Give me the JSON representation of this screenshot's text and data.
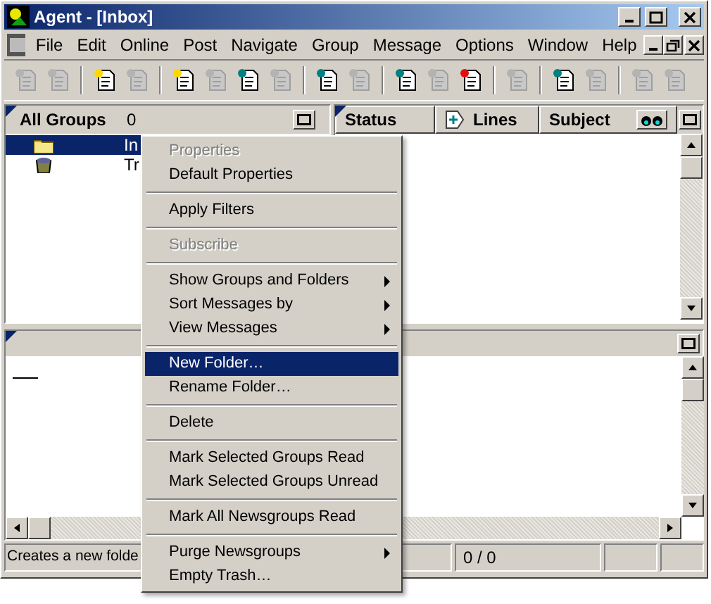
{
  "window": {
    "title": "Agent - [Inbox]"
  },
  "menu_bar": [
    "File",
    "Edit",
    "Online",
    "Post",
    "Navigate",
    "Group",
    "Message",
    "Options",
    "Window",
    "Help"
  ],
  "toolbar": [
    {
      "kind": "button",
      "disabled": true
    },
    {
      "kind": "button",
      "disabled": true
    },
    {
      "kind": "separator"
    },
    {
      "kind": "button",
      "disabled": false
    },
    {
      "kind": "button",
      "disabled": true
    },
    {
      "kind": "separator"
    },
    {
      "kind": "button",
      "disabled": false
    },
    {
      "kind": "button",
      "disabled": true
    },
    {
      "kind": "button",
      "disabled": false
    },
    {
      "kind": "button",
      "disabled": true
    },
    {
      "kind": "separator"
    },
    {
      "kind": "button",
      "disabled": false
    },
    {
      "kind": "button",
      "disabled": true
    },
    {
      "kind": "separator"
    },
    {
      "kind": "button",
      "disabled": false
    },
    {
      "kind": "button",
      "disabled": true
    },
    {
      "kind": "button",
      "disabled": false
    },
    {
      "kind": "separator"
    },
    {
      "kind": "button",
      "disabled": true
    },
    {
      "kind": "separator"
    },
    {
      "kind": "button",
      "disabled": false
    },
    {
      "kind": "button",
      "disabled": true
    },
    {
      "kind": "separator"
    },
    {
      "kind": "button",
      "disabled": true
    },
    {
      "kind": "button",
      "disabled": true
    }
  ],
  "groups_pane": {
    "title": "All Groups",
    "count": "0",
    "items": [
      {
        "label": "In",
        "kind": "folder",
        "selected": true
      },
      {
        "label": "Tr",
        "kind": "trash",
        "selected": false
      }
    ]
  },
  "message_list": {
    "columns": [
      "Status",
      "Lines",
      "Subject"
    ]
  },
  "status_bar": {
    "message": "Creates a new folde",
    "counter": "0 / 0"
  },
  "context_menu": [
    {
      "kind": "item",
      "label": "Properties",
      "disabled": true,
      "submenu": false,
      "selected": false
    },
    {
      "kind": "item",
      "label": "Default Properties",
      "disabled": false,
      "submenu": false,
      "selected": false
    },
    {
      "kind": "separator"
    },
    {
      "kind": "item",
      "label": "Apply Filters",
      "disabled": false,
      "submenu": false,
      "selected": false
    },
    {
      "kind": "separator"
    },
    {
      "kind": "item",
      "label": "Subscribe",
      "disabled": true,
      "submenu": false,
      "selected": false
    },
    {
      "kind": "separator"
    },
    {
      "kind": "item",
      "label": "Show Groups and Folders",
      "disabled": false,
      "submenu": true,
      "selected": false
    },
    {
      "kind": "item",
      "label": "Sort Messages by",
      "disabled": false,
      "submenu": true,
      "selected": false
    },
    {
      "kind": "item",
      "label": "View Messages",
      "disabled": false,
      "submenu": true,
      "selected": false
    },
    {
      "kind": "separator"
    },
    {
      "kind": "item",
      "label": "New Folder…",
      "disabled": false,
      "submenu": false,
      "selected": true
    },
    {
      "kind": "item",
      "label": "Rename Folder…",
      "disabled": false,
      "submenu": false,
      "selected": false
    },
    {
      "kind": "separator"
    },
    {
      "kind": "item",
      "label": "Delete",
      "disabled": false,
      "submenu": false,
      "selected": false
    },
    {
      "kind": "separator"
    },
    {
      "kind": "item",
      "label": "Mark Selected Groups Read",
      "disabled": false,
      "submenu": false,
      "selected": false
    },
    {
      "kind": "item",
      "label": "Mark Selected Groups Unread",
      "disabled": false,
      "submenu": false,
      "selected": false
    },
    {
      "kind": "separator"
    },
    {
      "kind": "item",
      "label": "Mark All Newsgroups Read",
      "disabled": false,
      "submenu": false,
      "selected": false
    },
    {
      "kind": "separator"
    },
    {
      "kind": "item",
      "label": "Purge Newsgroups",
      "disabled": false,
      "submenu": true,
      "selected": false
    },
    {
      "kind": "item",
      "label": "Empty Trash…",
      "disabled": false,
      "submenu": false,
      "selected": false
    }
  ]
}
